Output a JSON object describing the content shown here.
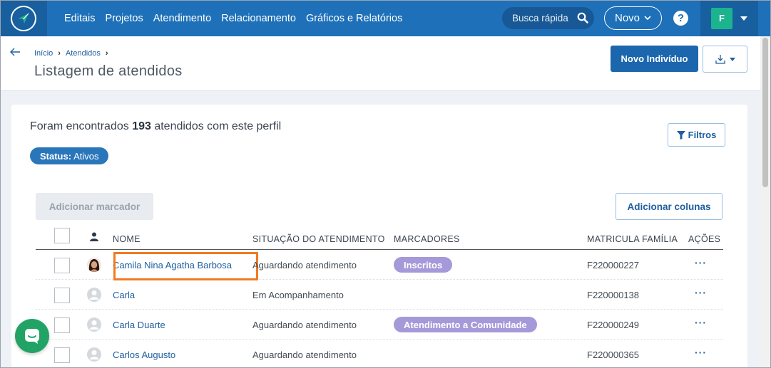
{
  "nav": {
    "links": [
      "Editais",
      "Projetos",
      "Atendimento",
      "Relacionamento",
      "Gráficos e Relatórios"
    ],
    "search_label": "Busca rápida",
    "novo_label": "Novo",
    "help_label": "?",
    "user_initial": "F"
  },
  "header": {
    "breadcrumb": [
      "Início",
      "Atendidos"
    ],
    "title": "Listagem de atendidos",
    "new_button": "Novo Indivíduo"
  },
  "summary": {
    "prefix": "Foram encontrados ",
    "count": "193",
    "suffix": " atendidos com este perfil"
  },
  "filter": {
    "status_label": "Status:",
    "status_value": "Ativos",
    "filtros_button": "Filtros"
  },
  "actions": {
    "add_marker": "Adicionar marcador",
    "add_columns": "Adicionar colunas"
  },
  "table": {
    "columns": [
      "NOME",
      "SITUAÇÃO DO ATENDIMENTO",
      "MARCADORES",
      "MATRICULA FAMÍLIA",
      "AÇÕES"
    ],
    "rows": [
      {
        "name": "Camila Nina Agatha Barbosa",
        "status": "Aguardando atendimento",
        "marker": "Inscritos",
        "matricula": "F220000227",
        "actions": "···"
      },
      {
        "name": "Carla",
        "status": "Em Acompanhamento",
        "marker": "",
        "matricula": "F220000138",
        "actions": "···"
      },
      {
        "name": "Carla Duarte",
        "status": "Aguardando atendimento",
        "marker": "Atendimento a Comunidade",
        "matricula": "F220000249",
        "actions": "···"
      },
      {
        "name": "Carlos Augusto",
        "status": "Aguardando atendimento",
        "marker": "",
        "matricula": "F220000365",
        "actions": "···"
      }
    ]
  },
  "colors": {
    "primary": "#1e70b9",
    "tag": "#a699d9",
    "highlight": "#f07b22",
    "chat": "#21a366"
  }
}
